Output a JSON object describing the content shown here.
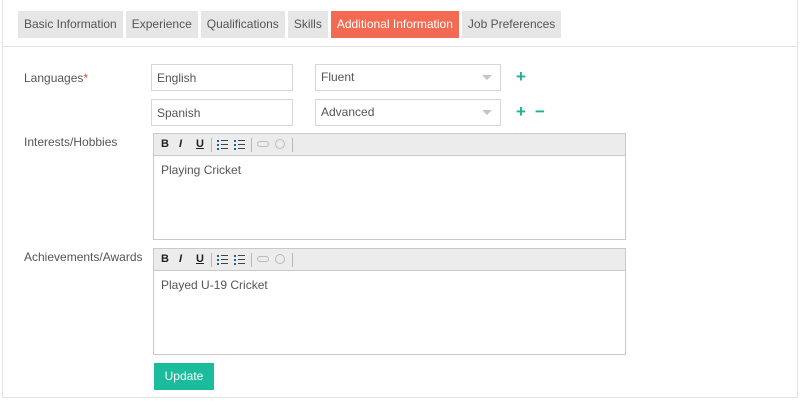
{
  "tabs": [
    {
      "label": "Basic Information",
      "active": false
    },
    {
      "label": "Experience",
      "active": false
    },
    {
      "label": "Qualifications",
      "active": false
    },
    {
      "label": "Skills",
      "active": false
    },
    {
      "label": "Additional Information",
      "active": true
    },
    {
      "label": "Job Preferences",
      "active": false
    }
  ],
  "languages": {
    "label": "Languages",
    "required_mark": "*",
    "rows": [
      {
        "language": "English",
        "level": "Fluent",
        "controls": [
          "add"
        ]
      },
      {
        "language": "Spanish",
        "level": "Advanced",
        "controls": [
          "add",
          "remove"
        ]
      }
    ]
  },
  "interests": {
    "label": "Interests/Hobbies",
    "content": "Playing Cricket"
  },
  "achievements": {
    "label": "Achievements/Awards",
    "content": "Played U-19 Cricket"
  },
  "toolbar": {
    "bold": "B",
    "italic": "I",
    "underline": "U"
  },
  "controls": {
    "add_symbol": "+",
    "remove_symbol": "−"
  },
  "update_button": "Update",
  "colors": {
    "active_tab": "#f26a52",
    "accent_green": "#1bbc9b",
    "required": "#e0463a"
  }
}
